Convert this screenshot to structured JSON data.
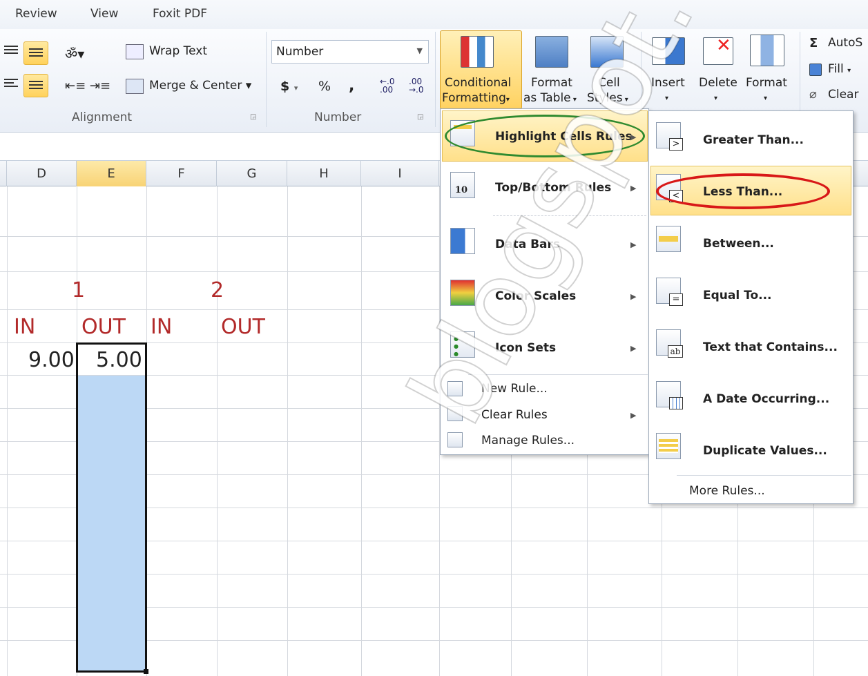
{
  "tabs": [
    "Review",
    "View",
    "Foxit PDF"
  ],
  "alignment": {
    "wrap_text": "Wrap Text",
    "merge_center": "Merge & Center",
    "group": "Alignment"
  },
  "number": {
    "format": "Number",
    "currency": "$",
    "percent": "%",
    "comma": ",",
    "inc_dec": ".00",
    "group": "Number"
  },
  "styles": {
    "cond_fmt_1": "Conditional",
    "cond_fmt_2": "Formatting",
    "fmt_table_1": "Format",
    "fmt_table_2": "as Table",
    "cell_styles_1": "Cell",
    "cell_styles_2": "Styles"
  },
  "cells": {
    "insert": "Insert",
    "delete": "Delete",
    "format": "Format"
  },
  "editing": {
    "autosum": "AutoS",
    "fill": "Fill",
    "clear": "Clear"
  },
  "columns": [
    "D",
    "E",
    "F",
    "G",
    "H",
    "I"
  ],
  "sheet": {
    "group1": "1",
    "group2": "2",
    "in1": "IN",
    "out1": "OUT",
    "in2": "IN",
    "out2": "OUT",
    "d_val": "9.00",
    "e_val": "5.00"
  },
  "cf_menu": {
    "items": [
      "Highlight Cells Rules",
      "Top/Bottom Rules",
      "Data Bars",
      "Color Scales",
      "Icon Sets"
    ],
    "actions": [
      "New Rule...",
      "Clear Rules",
      "Manage Rules..."
    ]
  },
  "sub_menu": {
    "items": [
      "Greater Than...",
      "Less Than...",
      "Between...",
      "Equal To...",
      "Text that Contains...",
      "A Date Occurring...",
      "Duplicate Values..."
    ],
    "more": "More Rules..."
  },
  "watermark": "blogspot.com",
  "colors": {
    "accent": "#ffd25c",
    "selection": "#bcd8f5",
    "red_text": "#b22a2a",
    "green_ring": "#2f8a2f",
    "red_ring": "#d81818"
  }
}
